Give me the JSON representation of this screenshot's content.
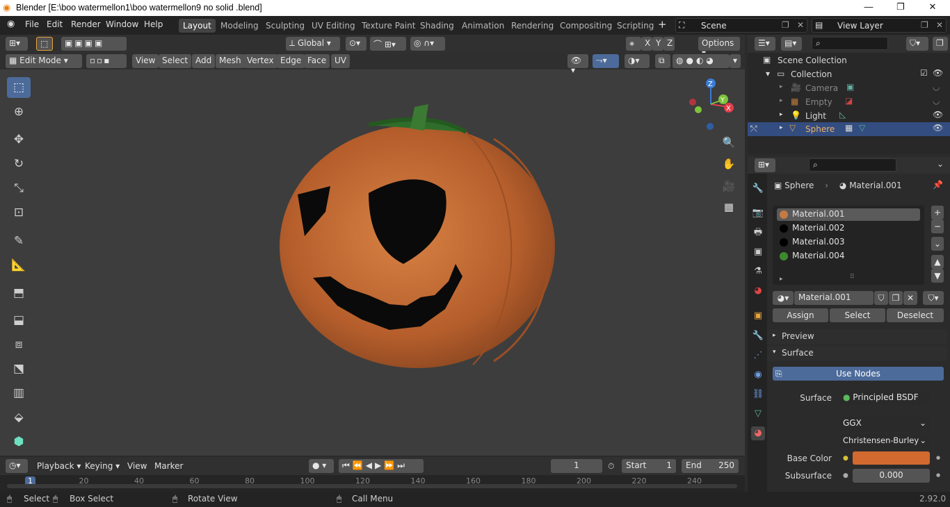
{
  "window": {
    "title": "Blender [E:\\boo watermellon1\\boo watermellon9 no solid .blend]"
  },
  "menu": {
    "items": [
      "File",
      "Edit",
      "Render",
      "Window",
      "Help"
    ]
  },
  "workspaces": [
    "Layout",
    "Modeling",
    "Sculpting",
    "UV Editing",
    "Texture Paint",
    "Shading",
    "Animation",
    "Rendering",
    "Compositing",
    "Scripting"
  ],
  "top": {
    "scene": "Scene",
    "view_layer": "View Layer"
  },
  "viewport": {
    "orientation": "Global",
    "options_label": "Options",
    "mode": "Edit Mode",
    "menus": [
      "View",
      "Select",
      "Add",
      "Mesh",
      "Vertex",
      "Edge",
      "Face",
      "UV"
    ]
  },
  "outliner": {
    "root": "Scene Collection",
    "collection": "Collection",
    "items": [
      "Camera",
      "Empty",
      "Light",
      "Sphere"
    ]
  },
  "properties": {
    "object": "Sphere",
    "material": "Material.001",
    "slots": [
      "Material.001",
      "Material.002",
      "Material.003",
      "Material.004"
    ],
    "slot_colors": [
      "#c47a45",
      "#000000",
      "#000000",
      "#3d8a2e"
    ],
    "material_field": "Material.001",
    "assign": "Assign",
    "select": "Select",
    "deselect": "Deselect",
    "preview": "Preview",
    "surface_panel": "Surface",
    "use_nodes": "Use Nodes",
    "surface_label": "Surface",
    "surface_value": "Principled BSDF",
    "distribution": "GGX",
    "subsurface_method": "Christensen-Burley",
    "base_color_label": "Base Color",
    "base_color": "#d2692f",
    "subsurface_label": "Subsurface",
    "subsurface_value": "0.000"
  },
  "timeline": {
    "menus": [
      "Playback",
      "Keying",
      "View",
      "Marker"
    ],
    "current_frame": "1",
    "start_label": "Start",
    "start": "1",
    "end_label": "End",
    "end": "250",
    "ruler": [
      "1",
      "20",
      "40",
      "60",
      "80",
      "100",
      "120",
      "140",
      "160",
      "180",
      "200",
      "220",
      "240"
    ]
  },
  "status": {
    "select": "Select",
    "box_select": "Box Select",
    "rotate": "Rotate View",
    "call_menu": "Call Menu",
    "version": "2.92.0"
  }
}
